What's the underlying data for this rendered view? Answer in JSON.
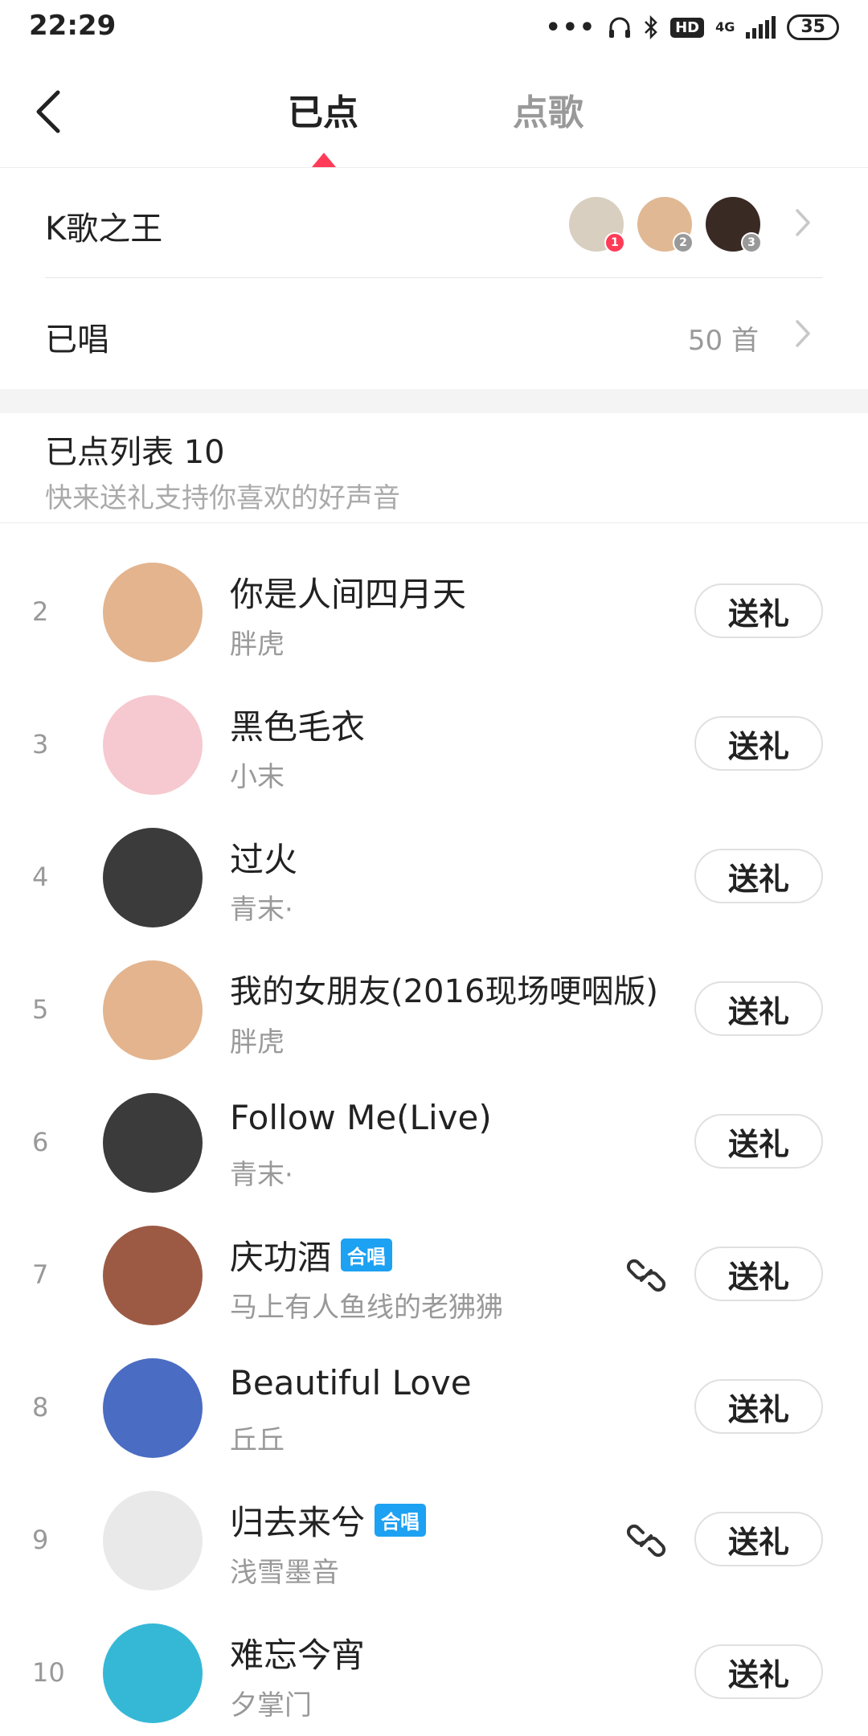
{
  "status_bar": {
    "time": "22:29",
    "hd": "HD",
    "network": "4G",
    "battery": "35"
  },
  "header": {
    "tab_active": "已点",
    "tab_inactive": "点歌"
  },
  "king_row": {
    "label": "K歌之王",
    "avatars": [
      {
        "rank": "1",
        "color": "#d8cfc0"
      },
      {
        "rank": "2",
        "color": "#e0b894"
      },
      {
        "rank": "3",
        "color": "#3a2a24"
      }
    ]
  },
  "sung_row": {
    "label": "已唱",
    "count": "50 首"
  },
  "list_header": {
    "title": "已点列表 10",
    "subtitle": "快来送礼支持你喜欢的好声音"
  },
  "colors": {
    "accent": "#ff3b57",
    "chorus": "#1da1f2"
  },
  "songs": [
    {
      "rank": "2",
      "title": "你是人间四月天",
      "singer": "胖虎",
      "chorus": false,
      "avatar_color": "#e3b48e",
      "gift_label": "送礼"
    },
    {
      "rank": "3",
      "title": "黑色毛衣",
      "singer": "小末",
      "chorus": false,
      "avatar_color": "#f5c9cf",
      "gift_label": "送礼"
    },
    {
      "rank": "4",
      "title": "过火",
      "singer": "青末·",
      "chorus": false,
      "avatar_color": "#3b3b3b",
      "gift_label": "送礼"
    },
    {
      "rank": "5",
      "title": "我的女朋友(2016现场哽咽版)",
      "singer": "胖虎",
      "chorus": false,
      "avatar_color": "#e3b48e",
      "gift_label": "送礼"
    },
    {
      "rank": "6",
      "title": "Follow Me(Live)",
      "singer": "青末·",
      "chorus": false,
      "avatar_color": "#3b3b3b",
      "gift_label": "送礼"
    },
    {
      "rank": "7",
      "title": "庆功酒",
      "singer": "马上有人鱼线的老狒狒",
      "chorus": true,
      "chorus_label": "合唱",
      "avatar_color": "#9c5a45",
      "gift_label": "送礼"
    },
    {
      "rank": "8",
      "title": "Beautiful Love",
      "singer": "丘丘",
      "chorus": false,
      "avatar_color": "#4a6cc2",
      "gift_label": "送礼"
    },
    {
      "rank": "9",
      "title": "归去来兮",
      "singer": "浅雪墨音",
      "chorus": true,
      "chorus_label": "合唱",
      "avatar_color": "#e9e9e9",
      "gift_label": "送礼"
    },
    {
      "rank": "10",
      "title": "难忘今宵",
      "singer": "夕掌门",
      "chorus": false,
      "avatar_color": "#35b8d6",
      "gift_label": "送礼"
    }
  ]
}
